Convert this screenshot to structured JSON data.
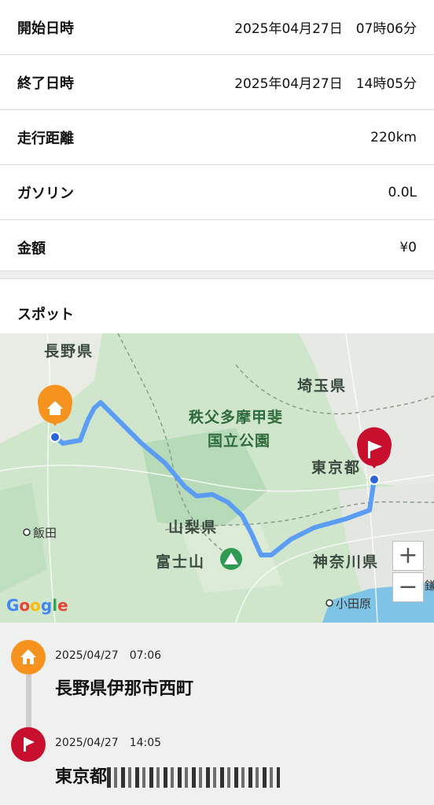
{
  "details": [
    {
      "label": "開始日時",
      "value": "2025年04月27日　07時06分"
    },
    {
      "label": "終了日時",
      "value": "2025年04月27日　14時05分"
    },
    {
      "label": "走行距離",
      "value": "220km"
    },
    {
      "label": "ガソリン",
      "value": "0.0L"
    },
    {
      "label": "金額",
      "value": "¥0"
    }
  ],
  "spot": {
    "title": "スポット"
  },
  "map": {
    "labels": {
      "nagano": "長野県",
      "saitama": "埼玉県",
      "park_line1": "秩父多摩甲斐",
      "park_line2": "国立公園",
      "tokyo": "東京都",
      "yamanashi": "山梨県",
      "fuji": "富士山",
      "kanagawa": "神奈川県",
      "iida": "飯田",
      "odawara": "小田原",
      "kama": "鎌"
    },
    "zoom_in": "+",
    "zoom_out": "−",
    "attribution": "Google",
    "route_color": "#5b9cf5",
    "start_color": "#f5931e",
    "goal_color": "#c8102e"
  },
  "timeline": {
    "start": {
      "date": "2025/04/27　07:06",
      "place": "長野県伊那市西町",
      "icon": "home-icon"
    },
    "end": {
      "date": "2025/04/27　14:05",
      "place": "東京都",
      "icon": "flag-icon"
    }
  }
}
